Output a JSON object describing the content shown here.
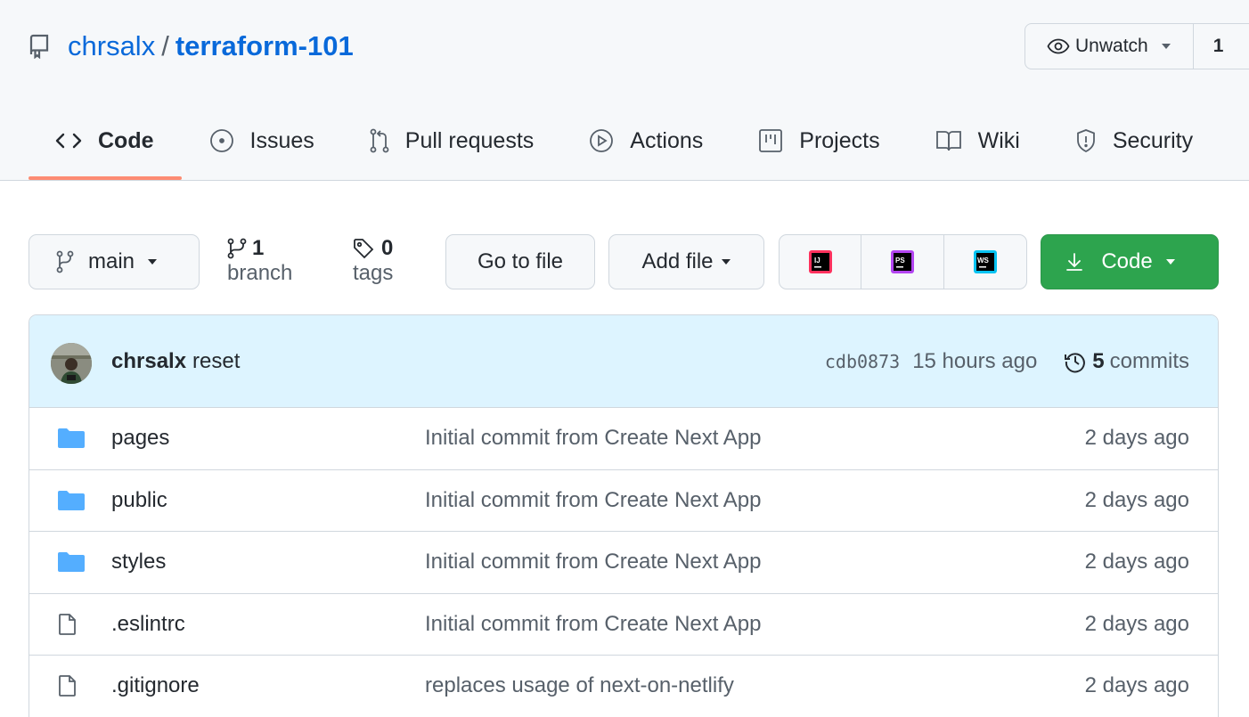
{
  "repo": {
    "owner": "chrsalx",
    "separator": "/",
    "name": "terraform-101"
  },
  "watch": {
    "label": "Unwatch",
    "count": "1"
  },
  "tabs": [
    {
      "label": "Code",
      "icon": "code-icon",
      "selected": true
    },
    {
      "label": "Issues",
      "icon": "issue-opened-icon",
      "selected": false
    },
    {
      "label": "Pull requests",
      "icon": "git-pull-request-icon",
      "selected": false
    },
    {
      "label": "Actions",
      "icon": "play-icon",
      "selected": false
    },
    {
      "label": "Projects",
      "icon": "table-icon",
      "selected": false
    },
    {
      "label": "Wiki",
      "icon": "book-icon",
      "selected": false
    },
    {
      "label": "Security",
      "icon": "shield-icon",
      "selected": false
    }
  ],
  "toolbar": {
    "branch_label": "main",
    "branches_count": "1",
    "branches_label": "branch",
    "tags_count": "0",
    "tags_label": "tags",
    "goto_label": "Go to file",
    "addfile_label": "Add file",
    "ide_icons": [
      "IJ",
      "PS",
      "WS"
    ],
    "code_label": "Code"
  },
  "latest_commit": {
    "author": "chrsalx",
    "message": "reset",
    "sha": "cdb0873",
    "time": "15 hours ago",
    "commits_count": "5",
    "commits_label": "commits"
  },
  "files": [
    {
      "name": "pages",
      "type": "folder",
      "message": "Initial commit from Create Next App",
      "age": "2 days ago"
    },
    {
      "name": "public",
      "type": "folder",
      "message": "Initial commit from Create Next App",
      "age": "2 days ago"
    },
    {
      "name": "styles",
      "type": "folder",
      "message": "Initial commit from Create Next App",
      "age": "2 days ago"
    },
    {
      "name": ".eslintrc",
      "type": "file",
      "message": "Initial commit from Create Next App",
      "age": "2 days ago"
    },
    {
      "name": ".gitignore",
      "type": "file",
      "message": "replaces usage of next-on-netlify",
      "age": "2 days ago"
    }
  ],
  "colors": {
    "link": "#0969da",
    "tab_underline": "#fd8c73",
    "code_button": "#2da44e",
    "commit_bar": "#ddf4ff",
    "folder": "#54aeff"
  }
}
